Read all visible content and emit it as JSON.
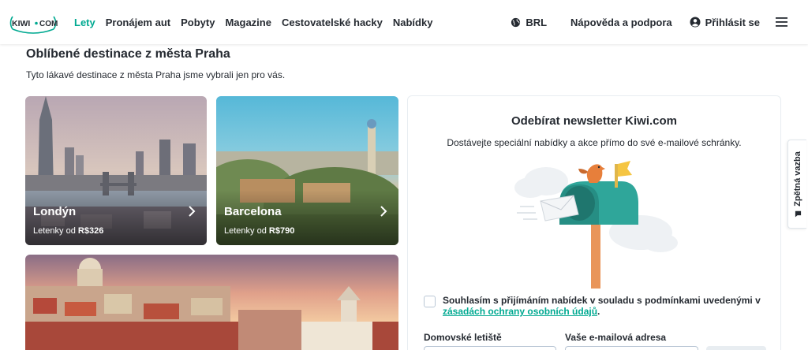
{
  "logo": {
    "text_left": "KIWI",
    "text_right": "COM"
  },
  "nav": {
    "items": [
      {
        "label": "Lety",
        "active": true
      },
      {
        "label": "Pronájem aut",
        "active": false
      },
      {
        "label": "Pobyty",
        "active": false
      },
      {
        "label": "Magazine",
        "active": false
      },
      {
        "label": "Cestovatelské hacky",
        "active": false
      },
      {
        "label": "Nabídky",
        "active": false
      }
    ]
  },
  "header_right": {
    "currency": "BRL",
    "help": "Nápověda a podpora",
    "login": "Přihlásit se"
  },
  "section": {
    "title": "Oblíbené destinace z města Praha",
    "subtitle": "Tyto lákavé destinace z města Praha jsme vybrali jen pro vás."
  },
  "cards": [
    {
      "city": "Londýn",
      "price_prefix": "Letenky od",
      "price": "R$326"
    },
    {
      "city": "Barcelona",
      "price_prefix": "Letenky od",
      "price": "R$790"
    }
  ],
  "newsletter": {
    "title": "Odebírat newsletter Kiwi.com",
    "subtitle": "Dostávejte speciální nabídky a akce přímo do své e-mailové schránky.",
    "consent_text": "Souhlasím s přijímáním nabídek v souladu s podmínkami uvedenými v",
    "consent_link": "zásadách ochrany osobních údajů",
    "consent_end": ".",
    "airport_label": "Domovské letiště",
    "email_label": "Vaše e-mailová adresa"
  },
  "feedback": {
    "label": "Zpětná vazba"
  },
  "colors": {
    "accent": "#00a991",
    "text": "#252a31",
    "mailbox": "#2fa69a",
    "bird": "#e77f3b",
    "flag": "#f5c542"
  },
  "icons": {
    "globe": "globe-icon",
    "user": "user-icon",
    "menu": "hamburger-icon",
    "chevron": "chevron-right-icon",
    "feedback": "speech-bubble-icon"
  }
}
